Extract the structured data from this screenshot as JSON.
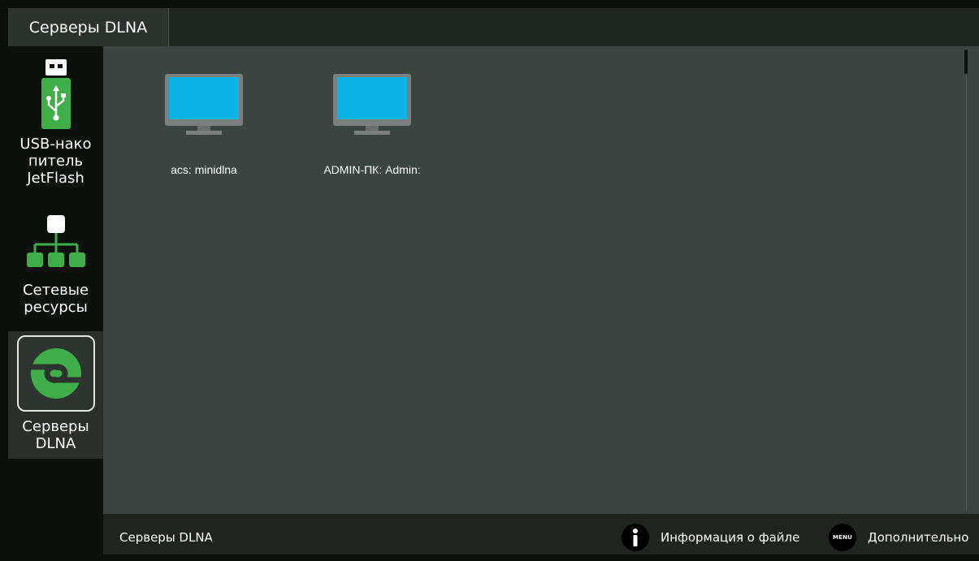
{
  "header": {
    "tab_title": "Серверы DLNA"
  },
  "sidebar": {
    "items": [
      {
        "label": "USB-нако питель JetFlash",
        "icon": "usb-drive-icon",
        "lines": [
          "USB-нако",
          "питель",
          "JetFlash"
        ]
      },
      {
        "label": "Сетевые ресурсы",
        "icon": "network-tree-icon",
        "lines": [
          "Сетевые",
          "ресурсы"
        ]
      },
      {
        "label": "Серверы DLNA",
        "icon": "dlna-icon",
        "lines": [
          "Серверы",
          "DLNA"
        ],
        "selected": true
      }
    ]
  },
  "main": {
    "servers": [
      {
        "name": "acs: minidlna",
        "icon": "monitor-icon"
      },
      {
        "name": "ADMIN-ПК: Admin:",
        "icon": "monitor-icon"
      }
    ]
  },
  "footer": {
    "breadcrumb": "Серверы DLNA",
    "info_label": "Информация о файле",
    "info_icon": "info-icon",
    "menu_badge": "MENU",
    "more_label": "Дополнительно",
    "menu_icon": "menu-button-icon"
  },
  "colors": {
    "accent_green": "#3fae49",
    "content_bg": "#3b4440",
    "screen_blue": "#0ab4e6"
  }
}
